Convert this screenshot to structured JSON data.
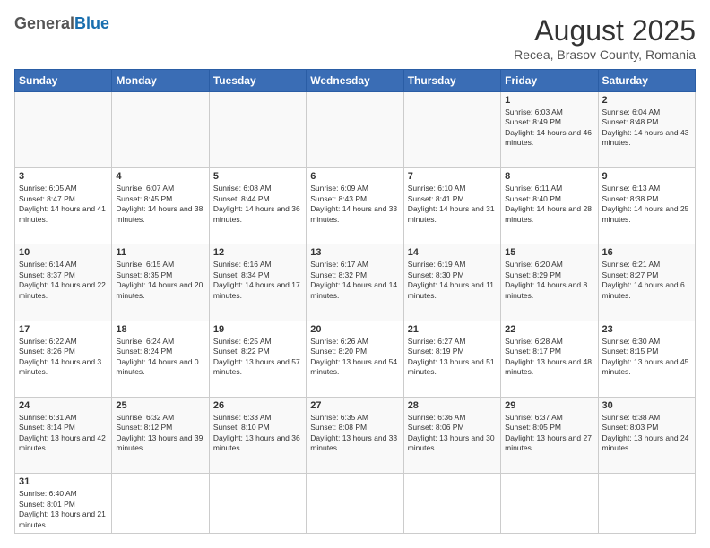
{
  "header": {
    "logo_general": "General",
    "logo_blue": "Blue",
    "month_title": "August 2025",
    "subtitle": "Recea, Brasov County, Romania"
  },
  "weekdays": [
    "Sunday",
    "Monday",
    "Tuesday",
    "Wednesday",
    "Thursday",
    "Friday",
    "Saturday"
  ],
  "weeks": [
    [
      {
        "day": "",
        "info": ""
      },
      {
        "day": "",
        "info": ""
      },
      {
        "day": "",
        "info": ""
      },
      {
        "day": "",
        "info": ""
      },
      {
        "day": "",
        "info": ""
      },
      {
        "day": "1",
        "info": "Sunrise: 6:03 AM\nSunset: 8:49 PM\nDaylight: 14 hours and 46 minutes."
      },
      {
        "day": "2",
        "info": "Sunrise: 6:04 AM\nSunset: 8:48 PM\nDaylight: 14 hours and 43 minutes."
      }
    ],
    [
      {
        "day": "3",
        "info": "Sunrise: 6:05 AM\nSunset: 8:47 PM\nDaylight: 14 hours and 41 minutes."
      },
      {
        "day": "4",
        "info": "Sunrise: 6:07 AM\nSunset: 8:45 PM\nDaylight: 14 hours and 38 minutes."
      },
      {
        "day": "5",
        "info": "Sunrise: 6:08 AM\nSunset: 8:44 PM\nDaylight: 14 hours and 36 minutes."
      },
      {
        "day": "6",
        "info": "Sunrise: 6:09 AM\nSunset: 8:43 PM\nDaylight: 14 hours and 33 minutes."
      },
      {
        "day": "7",
        "info": "Sunrise: 6:10 AM\nSunset: 8:41 PM\nDaylight: 14 hours and 31 minutes."
      },
      {
        "day": "8",
        "info": "Sunrise: 6:11 AM\nSunset: 8:40 PM\nDaylight: 14 hours and 28 minutes."
      },
      {
        "day": "9",
        "info": "Sunrise: 6:13 AM\nSunset: 8:38 PM\nDaylight: 14 hours and 25 minutes."
      }
    ],
    [
      {
        "day": "10",
        "info": "Sunrise: 6:14 AM\nSunset: 8:37 PM\nDaylight: 14 hours and 22 minutes."
      },
      {
        "day": "11",
        "info": "Sunrise: 6:15 AM\nSunset: 8:35 PM\nDaylight: 14 hours and 20 minutes."
      },
      {
        "day": "12",
        "info": "Sunrise: 6:16 AM\nSunset: 8:34 PM\nDaylight: 14 hours and 17 minutes."
      },
      {
        "day": "13",
        "info": "Sunrise: 6:17 AM\nSunset: 8:32 PM\nDaylight: 14 hours and 14 minutes."
      },
      {
        "day": "14",
        "info": "Sunrise: 6:19 AM\nSunset: 8:30 PM\nDaylight: 14 hours and 11 minutes."
      },
      {
        "day": "15",
        "info": "Sunrise: 6:20 AM\nSunset: 8:29 PM\nDaylight: 14 hours and 8 minutes."
      },
      {
        "day": "16",
        "info": "Sunrise: 6:21 AM\nSunset: 8:27 PM\nDaylight: 14 hours and 6 minutes."
      }
    ],
    [
      {
        "day": "17",
        "info": "Sunrise: 6:22 AM\nSunset: 8:26 PM\nDaylight: 14 hours and 3 minutes."
      },
      {
        "day": "18",
        "info": "Sunrise: 6:24 AM\nSunset: 8:24 PM\nDaylight: 14 hours and 0 minutes."
      },
      {
        "day": "19",
        "info": "Sunrise: 6:25 AM\nSunset: 8:22 PM\nDaylight: 13 hours and 57 minutes."
      },
      {
        "day": "20",
        "info": "Sunrise: 6:26 AM\nSunset: 8:20 PM\nDaylight: 13 hours and 54 minutes."
      },
      {
        "day": "21",
        "info": "Sunrise: 6:27 AM\nSunset: 8:19 PM\nDaylight: 13 hours and 51 minutes."
      },
      {
        "day": "22",
        "info": "Sunrise: 6:28 AM\nSunset: 8:17 PM\nDaylight: 13 hours and 48 minutes."
      },
      {
        "day": "23",
        "info": "Sunrise: 6:30 AM\nSunset: 8:15 PM\nDaylight: 13 hours and 45 minutes."
      }
    ],
    [
      {
        "day": "24",
        "info": "Sunrise: 6:31 AM\nSunset: 8:14 PM\nDaylight: 13 hours and 42 minutes."
      },
      {
        "day": "25",
        "info": "Sunrise: 6:32 AM\nSunset: 8:12 PM\nDaylight: 13 hours and 39 minutes."
      },
      {
        "day": "26",
        "info": "Sunrise: 6:33 AM\nSunset: 8:10 PM\nDaylight: 13 hours and 36 minutes."
      },
      {
        "day": "27",
        "info": "Sunrise: 6:35 AM\nSunset: 8:08 PM\nDaylight: 13 hours and 33 minutes."
      },
      {
        "day": "28",
        "info": "Sunrise: 6:36 AM\nSunset: 8:06 PM\nDaylight: 13 hours and 30 minutes."
      },
      {
        "day": "29",
        "info": "Sunrise: 6:37 AM\nSunset: 8:05 PM\nDaylight: 13 hours and 27 minutes."
      },
      {
        "day": "30",
        "info": "Sunrise: 6:38 AM\nSunset: 8:03 PM\nDaylight: 13 hours and 24 minutes."
      }
    ],
    [
      {
        "day": "31",
        "info": "Sunrise: 6:40 AM\nSunset: 8:01 PM\nDaylight: 13 hours and 21 minutes."
      },
      {
        "day": "",
        "info": ""
      },
      {
        "day": "",
        "info": ""
      },
      {
        "day": "",
        "info": ""
      },
      {
        "day": "",
        "info": ""
      },
      {
        "day": "",
        "info": ""
      },
      {
        "day": "",
        "info": ""
      }
    ]
  ]
}
